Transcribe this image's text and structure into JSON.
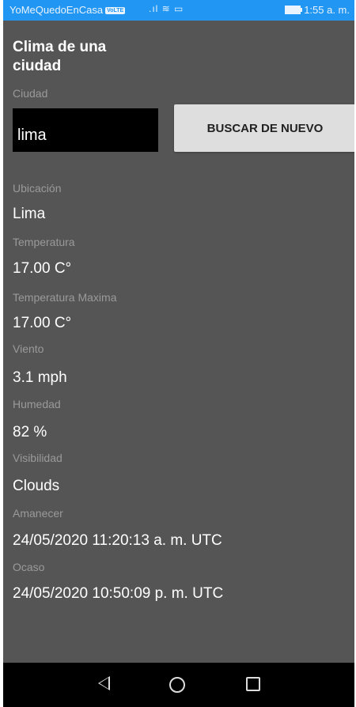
{
  "status_bar": {
    "app_name": "YoMeQuedoEnCasa",
    "badge": "VoLTE",
    "signal": ".ıl ≋ ▭",
    "time": "1:55 a. m."
  },
  "app": {
    "title": "Clima de una ciudad",
    "city_label": "Ciudad",
    "city_value": "lima",
    "search_button": "BUSCAR DE NUEVO"
  },
  "results": [
    {
      "label": "Ubicación",
      "value": "Lima"
    },
    {
      "label": "Temperatura",
      "value": "17.00 C°"
    },
    {
      "label": "Temperatura Maxima",
      "value": "17.00 C°"
    },
    {
      "label": "Viento",
      "value": "3.1 mph"
    },
    {
      "label": "Humedad",
      "value": "82 %"
    },
    {
      "label": "Visibilidad",
      "value": "Clouds"
    },
    {
      "label": "Amanecer",
      "value": "24/05/2020 11:20:13 a. m. UTC"
    },
    {
      "label": "Ocaso",
      "value": "24/05/2020 10:50:09 p. m. UTC"
    }
  ],
  "nav": {
    "back": "back-icon",
    "home": "home-icon",
    "recent": "recent-apps-icon"
  },
  "colors": {
    "status_bar": "#2196f3",
    "background": "#555555",
    "label": "#9a9a9a",
    "input_bg": "#000000",
    "button_bg": "#dedede"
  }
}
